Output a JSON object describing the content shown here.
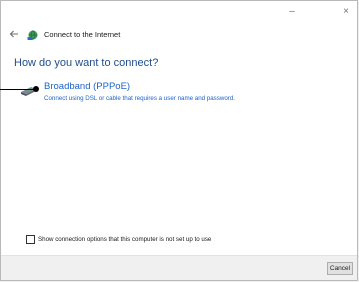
{
  "window": {
    "minimize_glyph": "–",
    "close_glyph": "×"
  },
  "nav": {
    "title": "Connect to the Internet",
    "back_icon": "back-arrow-icon",
    "app_icon": "network-globe-icon"
  },
  "heading": "How do you want to connect?",
  "options": [
    {
      "title": "Broadband (PPPoE)",
      "description": "Connect using DSL or cable that requires a user name and password.",
      "icon": "broadband-modem-icon"
    }
  ],
  "checkbox": {
    "label": "Show connection options that this computer is not set up to use",
    "checked": false
  },
  "footer": {
    "cancel_label": "Cancel"
  },
  "colors": {
    "heading": "#1f4e8c",
    "link": "#1e63c8",
    "footer_bg": "#f0f0f0"
  }
}
